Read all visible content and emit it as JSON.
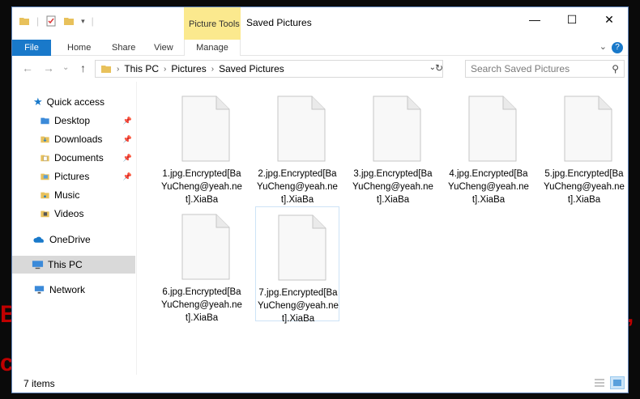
{
  "window": {
    "title": "Saved Pictures",
    "context_tab": "Picture Tools",
    "controls": {
      "minimize": "—",
      "maximize": "☐",
      "close": "✕"
    }
  },
  "ribbon": {
    "tabs": [
      "File",
      "Home",
      "Share",
      "View",
      "Manage"
    ],
    "help": "?",
    "collapse": "⌄"
  },
  "address": {
    "crumbs": [
      "This PC",
      "Pictures",
      "Saved Pictures"
    ],
    "search_placeholder": "Search Saved Pictures",
    "back": "←",
    "forward": "→",
    "recent": "⌄",
    "up": "↑",
    "refresh": "↻"
  },
  "nav": {
    "items": [
      {
        "label": "Quick access",
        "icon": "star-icon"
      },
      {
        "label": "Desktop",
        "icon": "folder-icon",
        "pinned": true
      },
      {
        "label": "Downloads",
        "icon": "downloads-folder-icon",
        "pinned": true
      },
      {
        "label": "Documents",
        "icon": "documents-folder-icon",
        "pinned": true
      },
      {
        "label": "Pictures",
        "icon": "pictures-folder-icon",
        "pinned": true
      },
      {
        "label": "Music",
        "icon": "music-folder-icon"
      },
      {
        "label": "Videos",
        "icon": "videos-folder-icon"
      },
      {
        "label": "OneDrive",
        "icon": "cloud-icon"
      },
      {
        "label": "This PC",
        "icon": "computer-icon",
        "selected": true
      },
      {
        "label": "Network",
        "icon": "network-icon"
      }
    ]
  },
  "files": [
    {
      "name": "1.jpg.Encrypted[BaYuCheng@yeah.net].XiaBa"
    },
    {
      "name": "2.jpg.Encrypted[BaYuCheng@yeah.net].XiaBa"
    },
    {
      "name": "3.jpg.Encrypted[BaYuCheng@yeah.net].XiaBa"
    },
    {
      "name": "4.jpg.Encrypted[BaYuCheng@yeah.net].XiaBa"
    },
    {
      "name": "5.jpg.Encrypted[BaYuCheng@yeah.net].XiaBa"
    },
    {
      "name": "6.jpg.Encrypted[BaYuCheng@yeah.net].XiaBa"
    },
    {
      "name": "7.jpg.Encrypted[BaYuCheng@yeah.net].XiaBa",
      "focused": true
    }
  ],
  "status": {
    "item_count": "7 items"
  },
  "colors": {
    "accent": "#1979ca",
    "context_tab": "#fbe98e",
    "selection": "#d9d9d9"
  }
}
